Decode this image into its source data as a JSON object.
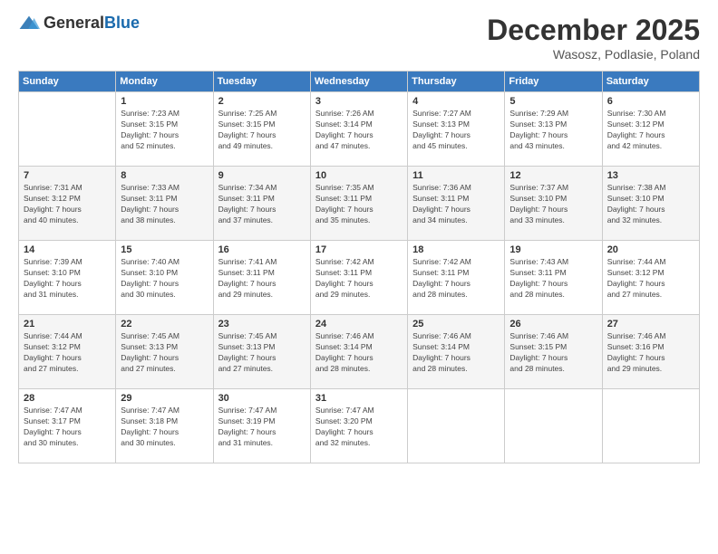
{
  "header": {
    "logo_general": "General",
    "logo_blue": "Blue",
    "month_title": "December 2025",
    "location": "Wasosz, Podlasie, Poland"
  },
  "days_of_week": [
    "Sunday",
    "Monday",
    "Tuesday",
    "Wednesday",
    "Thursday",
    "Friday",
    "Saturday"
  ],
  "weeks": [
    [
      {
        "day": "",
        "info": ""
      },
      {
        "day": "1",
        "info": "Sunrise: 7:23 AM\nSunset: 3:15 PM\nDaylight: 7 hours\nand 52 minutes."
      },
      {
        "day": "2",
        "info": "Sunrise: 7:25 AM\nSunset: 3:15 PM\nDaylight: 7 hours\nand 49 minutes."
      },
      {
        "day": "3",
        "info": "Sunrise: 7:26 AM\nSunset: 3:14 PM\nDaylight: 7 hours\nand 47 minutes."
      },
      {
        "day": "4",
        "info": "Sunrise: 7:27 AM\nSunset: 3:13 PM\nDaylight: 7 hours\nand 45 minutes."
      },
      {
        "day": "5",
        "info": "Sunrise: 7:29 AM\nSunset: 3:13 PM\nDaylight: 7 hours\nand 43 minutes."
      },
      {
        "day": "6",
        "info": "Sunrise: 7:30 AM\nSunset: 3:12 PM\nDaylight: 7 hours\nand 42 minutes."
      }
    ],
    [
      {
        "day": "7",
        "info": "Sunrise: 7:31 AM\nSunset: 3:12 PM\nDaylight: 7 hours\nand 40 minutes."
      },
      {
        "day": "8",
        "info": "Sunrise: 7:33 AM\nSunset: 3:11 PM\nDaylight: 7 hours\nand 38 minutes."
      },
      {
        "day": "9",
        "info": "Sunrise: 7:34 AM\nSunset: 3:11 PM\nDaylight: 7 hours\nand 37 minutes."
      },
      {
        "day": "10",
        "info": "Sunrise: 7:35 AM\nSunset: 3:11 PM\nDaylight: 7 hours\nand 35 minutes."
      },
      {
        "day": "11",
        "info": "Sunrise: 7:36 AM\nSunset: 3:11 PM\nDaylight: 7 hours\nand 34 minutes."
      },
      {
        "day": "12",
        "info": "Sunrise: 7:37 AM\nSunset: 3:10 PM\nDaylight: 7 hours\nand 33 minutes."
      },
      {
        "day": "13",
        "info": "Sunrise: 7:38 AM\nSunset: 3:10 PM\nDaylight: 7 hours\nand 32 minutes."
      }
    ],
    [
      {
        "day": "14",
        "info": "Sunrise: 7:39 AM\nSunset: 3:10 PM\nDaylight: 7 hours\nand 31 minutes."
      },
      {
        "day": "15",
        "info": "Sunrise: 7:40 AM\nSunset: 3:10 PM\nDaylight: 7 hours\nand 30 minutes."
      },
      {
        "day": "16",
        "info": "Sunrise: 7:41 AM\nSunset: 3:11 PM\nDaylight: 7 hours\nand 29 minutes."
      },
      {
        "day": "17",
        "info": "Sunrise: 7:42 AM\nSunset: 3:11 PM\nDaylight: 7 hours\nand 29 minutes."
      },
      {
        "day": "18",
        "info": "Sunrise: 7:42 AM\nSunset: 3:11 PM\nDaylight: 7 hours\nand 28 minutes."
      },
      {
        "day": "19",
        "info": "Sunrise: 7:43 AM\nSunset: 3:11 PM\nDaylight: 7 hours\nand 28 minutes."
      },
      {
        "day": "20",
        "info": "Sunrise: 7:44 AM\nSunset: 3:12 PM\nDaylight: 7 hours\nand 27 minutes."
      }
    ],
    [
      {
        "day": "21",
        "info": "Sunrise: 7:44 AM\nSunset: 3:12 PM\nDaylight: 7 hours\nand 27 minutes."
      },
      {
        "day": "22",
        "info": "Sunrise: 7:45 AM\nSunset: 3:13 PM\nDaylight: 7 hours\nand 27 minutes."
      },
      {
        "day": "23",
        "info": "Sunrise: 7:45 AM\nSunset: 3:13 PM\nDaylight: 7 hours\nand 27 minutes."
      },
      {
        "day": "24",
        "info": "Sunrise: 7:46 AM\nSunset: 3:14 PM\nDaylight: 7 hours\nand 28 minutes."
      },
      {
        "day": "25",
        "info": "Sunrise: 7:46 AM\nSunset: 3:14 PM\nDaylight: 7 hours\nand 28 minutes."
      },
      {
        "day": "26",
        "info": "Sunrise: 7:46 AM\nSunset: 3:15 PM\nDaylight: 7 hours\nand 28 minutes."
      },
      {
        "day": "27",
        "info": "Sunrise: 7:46 AM\nSunset: 3:16 PM\nDaylight: 7 hours\nand 29 minutes."
      }
    ],
    [
      {
        "day": "28",
        "info": "Sunrise: 7:47 AM\nSunset: 3:17 PM\nDaylight: 7 hours\nand 30 minutes."
      },
      {
        "day": "29",
        "info": "Sunrise: 7:47 AM\nSunset: 3:18 PM\nDaylight: 7 hours\nand 30 minutes."
      },
      {
        "day": "30",
        "info": "Sunrise: 7:47 AM\nSunset: 3:19 PM\nDaylight: 7 hours\nand 31 minutes."
      },
      {
        "day": "31",
        "info": "Sunrise: 7:47 AM\nSunset: 3:20 PM\nDaylight: 7 hours\nand 32 minutes."
      },
      {
        "day": "",
        "info": ""
      },
      {
        "day": "",
        "info": ""
      },
      {
        "day": "",
        "info": ""
      }
    ]
  ]
}
